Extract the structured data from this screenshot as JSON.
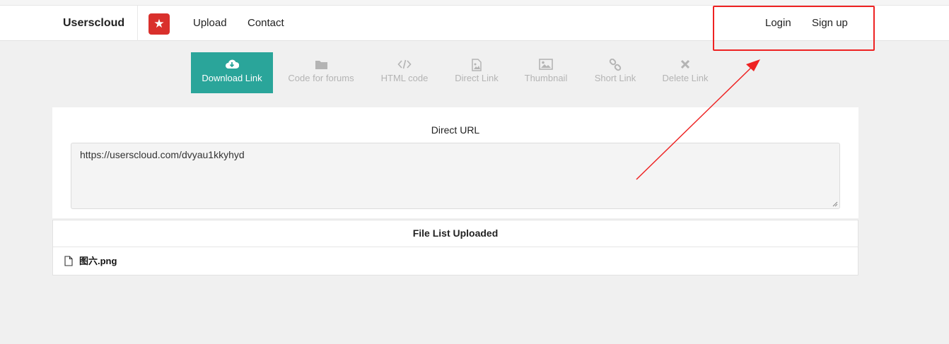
{
  "navbar": {
    "brand": "Userscloud",
    "links": [
      {
        "label": "Upload"
      },
      {
        "label": "Contact"
      }
    ],
    "auth": {
      "login": "Login",
      "signup": "Sign up"
    }
  },
  "tabs": [
    {
      "label": "Download Link",
      "icon": "cloud-download-icon",
      "active": true
    },
    {
      "label": "Code for forums",
      "icon": "folder-icon"
    },
    {
      "label": "HTML code",
      "icon": "code-icon"
    },
    {
      "label": "Direct Link",
      "icon": "image-file-icon"
    },
    {
      "label": "Thumbnail",
      "icon": "picture-icon"
    },
    {
      "label": "Short Link",
      "icon": "link-icon"
    },
    {
      "label": "Delete Link",
      "icon": "x-icon"
    }
  ],
  "panel": {
    "title": "Direct URL",
    "url": "https://userscloud.com/dvyau1kkyhyd"
  },
  "file_list": {
    "title": "File List Uploaded",
    "files": [
      {
        "name": "图六.png",
        "icon": "file-icon"
      }
    ]
  },
  "colors": {
    "accent": "#2aa59a",
    "brand_badge": "#d9302c",
    "annotation": "#ee2222"
  }
}
